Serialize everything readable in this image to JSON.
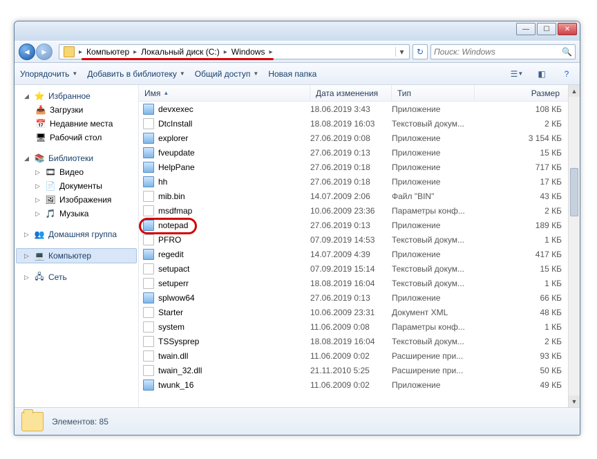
{
  "breadcrumb": {
    "seg1": "Компьютер",
    "seg2": "Локальный диск (C:)",
    "seg3": "Windows"
  },
  "search": {
    "placeholder": "Поиск: Windows"
  },
  "toolbar": {
    "organize": "Упорядочить",
    "addlib": "Добавить в библиотеку",
    "share": "Общий доступ",
    "newfolder": "Новая папка"
  },
  "sidebar": {
    "fav": "Избранное",
    "downloads": "Загрузки",
    "recent": "Недавние места",
    "desktop": "Рабочий стол",
    "libs": "Библиотеки",
    "video": "Видео",
    "docs": "Документы",
    "pics": "Изображения",
    "music": "Музыка",
    "homegroup": "Домашняя группа",
    "computer": "Компьютер",
    "network": "Сеть"
  },
  "columns": {
    "name": "Имя",
    "date": "Дата изменения",
    "type": "Тип",
    "size": "Размер"
  },
  "files": [
    {
      "name": "devxexec",
      "date": "18.06.2019 3:43",
      "type": "Приложение",
      "size": "108 КБ",
      "icon": "app"
    },
    {
      "name": "DtcInstall",
      "date": "18.08.2019 16:03",
      "type": "Текстовый докум...",
      "size": "2 КБ",
      "icon": "txt"
    },
    {
      "name": "explorer",
      "date": "27.06.2019 0:08",
      "type": "Приложение",
      "size": "3 154 КБ",
      "icon": "app"
    },
    {
      "name": "fveupdate",
      "date": "27.06.2019 0:13",
      "type": "Приложение",
      "size": "15 КБ",
      "icon": "app"
    },
    {
      "name": "HelpPane",
      "date": "27.06.2019 0:18",
      "type": "Приложение",
      "size": "717 КБ",
      "icon": "app"
    },
    {
      "name": "hh",
      "date": "27.06.2019 0:18",
      "type": "Приложение",
      "size": "17 КБ",
      "icon": "app"
    },
    {
      "name": "mib.bin",
      "date": "14.07.2009 2:06",
      "type": "Файл \"BIN\"",
      "size": "43 КБ",
      "icon": "bin"
    },
    {
      "name": "msdfmap",
      "date": "10.06.2009 23:36",
      "type": "Параметры конф...",
      "size": "2 КБ",
      "icon": "ini"
    },
    {
      "name": "notepad",
      "date": "27.06.2019 0:13",
      "type": "Приложение",
      "size": "189 КБ",
      "icon": "app"
    },
    {
      "name": "PFRO",
      "date": "07.09.2019 14:53",
      "type": "Текстовый докум...",
      "size": "1 КБ",
      "icon": "txt"
    },
    {
      "name": "regedit",
      "date": "14.07.2009 4:39",
      "type": "Приложение",
      "size": "417 КБ",
      "icon": "app"
    },
    {
      "name": "setupact",
      "date": "07.09.2019 15:14",
      "type": "Текстовый докум...",
      "size": "15 КБ",
      "icon": "txt"
    },
    {
      "name": "setuperr",
      "date": "18.08.2019 16:04",
      "type": "Текстовый докум...",
      "size": "1 КБ",
      "icon": "txt"
    },
    {
      "name": "splwow64",
      "date": "27.06.2019 0:13",
      "type": "Приложение",
      "size": "66 КБ",
      "icon": "app"
    },
    {
      "name": "Starter",
      "date": "10.06.2009 23:31",
      "type": "Документ XML",
      "size": "48 КБ",
      "icon": "xml"
    },
    {
      "name": "system",
      "date": "11.06.2009 0:08",
      "type": "Параметры конф...",
      "size": "1 КБ",
      "icon": "ini"
    },
    {
      "name": "TSSysprep",
      "date": "18.08.2019 16:04",
      "type": "Текстовый докум...",
      "size": "2 КБ",
      "icon": "txt"
    },
    {
      "name": "twain.dll",
      "date": "11.06.2009 0:02",
      "type": "Расширение при...",
      "size": "93 КБ",
      "icon": "dll"
    },
    {
      "name": "twain_32.dll",
      "date": "21.11.2010 5:25",
      "type": "Расширение при...",
      "size": "50 КБ",
      "icon": "dll"
    },
    {
      "name": "twunk_16",
      "date": "11.06.2009 0:02",
      "type": "Приложение",
      "size": "49 КБ",
      "icon": "app"
    }
  ],
  "status": {
    "count_label": "Элементов: 85"
  }
}
